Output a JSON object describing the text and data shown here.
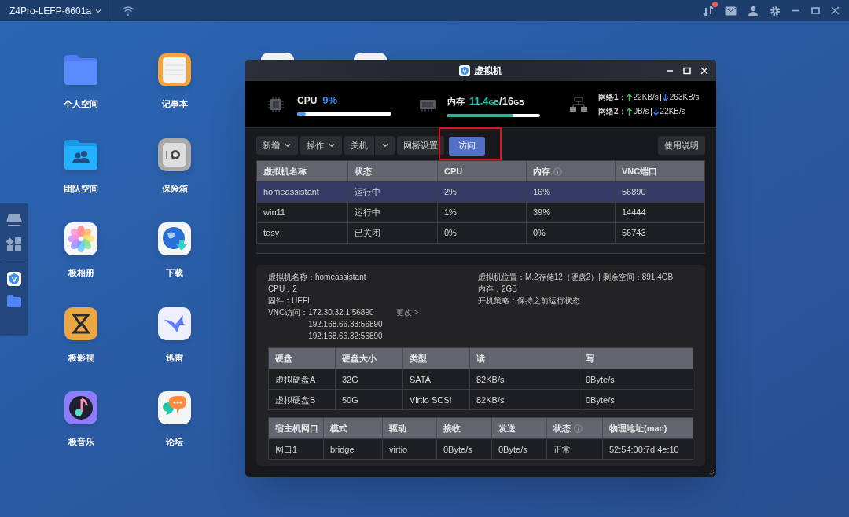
{
  "top_bar": {
    "device_name": "Z4Pro-LEFP-6601a",
    "notification": true
  },
  "desktop_apps": [
    {
      "label": "个人空间",
      "kind": "folder"
    },
    {
      "label": "记事本",
      "kind": "notes"
    },
    {
      "label": "团队空间",
      "kind": "team"
    },
    {
      "label": "保险箱",
      "kind": "safe"
    },
    {
      "label": "极相册",
      "kind": "photos"
    },
    {
      "label": "下载",
      "kind": "download"
    },
    {
      "label": "极影视",
      "kind": "video"
    },
    {
      "label": "迅雷",
      "kind": "bird"
    },
    {
      "label": "极音乐",
      "kind": "music"
    },
    {
      "label": "论坛",
      "kind": "forum"
    }
  ],
  "vm_window": {
    "title": "虚拟机",
    "stats": {
      "cpu": {
        "label": "CPU",
        "value": "9%",
        "level": 0.09
      },
      "memory": {
        "label": "内存",
        "used": "11.4",
        "used_unit": "GB",
        "separator": "/",
        "total": "16",
        "total_unit": "GB",
        "level": 0.71
      },
      "network": [
        {
          "label": "网络1：",
          "up": "22KB/s",
          "down": "263KB/s"
        },
        {
          "label": "网络2：",
          "up": "0B/s",
          "down": "22KB/s"
        }
      ]
    },
    "toolbar": [
      {
        "label": "新增",
        "kind": "dropdown"
      },
      {
        "label": "操作",
        "kind": "dropdown"
      },
      {
        "label": "关机",
        "kind": "split"
      },
      {
        "label": "网桥设置",
        "kind": "plain"
      },
      {
        "label": "访问",
        "kind": "primary"
      }
    ],
    "help_button": "使用说明",
    "vm_table": {
      "columns": [
        {
          "label": "虚拟机名称",
          "info": false
        },
        {
          "label": "状态",
          "info": false
        },
        {
          "label": "CPU",
          "info": false
        },
        {
          "label": "内存",
          "info": true
        },
        {
          "label": "VNC端口",
          "info": false
        }
      ],
      "rows": [
        {
          "cells": [
            "homeassistant",
            "运行中",
            "2%",
            "16%",
            "56890"
          ],
          "selected": true
        },
        {
          "cells": [
            "win11",
            "运行中",
            "1%",
            "39%",
            "14444"
          ],
          "selected": false
        },
        {
          "cells": [
            "tesy",
            "已关闭",
            "0%",
            "0%",
            "56743"
          ],
          "selected": false
        }
      ]
    },
    "details": {
      "left": [
        {
          "label": "虚拟机名称：",
          "value": "homeassistant"
        },
        {
          "label": "CPU：",
          "value": "2"
        },
        {
          "label": "固件：",
          "value": "UEFI"
        }
      ],
      "vnc": {
        "label": "VNC访问：",
        "addresses": [
          "172.30.32.1:56890",
          "192.168.66.33:56890",
          "192.168.66.32:56890"
        ],
        "change_link": "更改 >"
      },
      "right": [
        {
          "label": "虚拟机位置：",
          "value": "M.2存储12（硬盘2）| 剩余空间：891.4GB"
        },
        {
          "label": "内存：",
          "value": "2GB"
        },
        {
          "label": "开机策略：",
          "value": "保持之前运行状态"
        }
      ],
      "disk_table": {
        "columns": [
          {
            "label": "硬盘",
            "info": false
          },
          {
            "label": "硬盘大小",
            "info": false
          },
          {
            "label": "类型",
            "info": false
          },
          {
            "label": "读",
            "info": false
          },
          {
            "label": "写",
            "info": false
          }
        ],
        "rows": [
          [
            "虚拟硬盘A",
            "32G",
            "SATA",
            "82KB/s",
            "0Byte/s"
          ],
          [
            "虚拟硬盘B",
            "50G",
            "Virtio SCSI",
            "82KB/s",
            "0Byte/s"
          ]
        ]
      },
      "nic_table": {
        "columns": [
          {
            "label": "宿主机网口",
            "info": false
          },
          {
            "label": "模式",
            "info": false
          },
          {
            "label": "驱动",
            "info": false
          },
          {
            "label": "接收",
            "info": false
          },
          {
            "label": "发送",
            "info": false
          },
          {
            "label": "状态",
            "info": true
          },
          {
            "label": "物理地址(mac)",
            "info": false
          }
        ],
        "rows": [
          [
            "网口1",
            "bridge",
            "virtio",
            "0Byte/s",
            "0Byte/s",
            "正常",
            "52:54:00:7d:4e:10"
          ]
        ]
      }
    }
  }
}
